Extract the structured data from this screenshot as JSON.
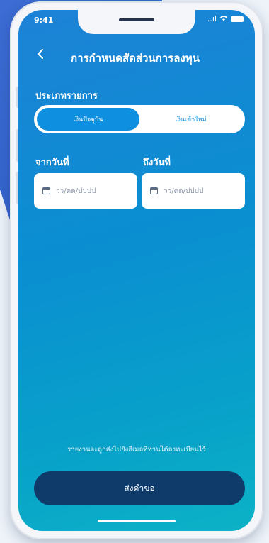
{
  "status": {
    "time": "9:41",
    "signal": "..ıl"
  },
  "header": {
    "back_icon": "chevron-left-icon",
    "title": "การกำหนดสัดส่วนการลงทุน"
  },
  "type_section": {
    "label": "ประเภทรายการ",
    "options": [
      {
        "label": "เงินปัจจุบัน",
        "selected": true
      },
      {
        "label": "เงินเข้าใหม่",
        "selected": false
      }
    ]
  },
  "date_range": {
    "from": {
      "label": "จากวันที่",
      "placeholder": "วว/ดด/ปปปป",
      "icon": "calendar-icon"
    },
    "to": {
      "label": "ถึงวันที่",
      "placeholder": "วว/ดด/ปปปป",
      "icon": "calendar-icon"
    }
  },
  "footer": {
    "note": "รายงานจะถูกส่งไปยังอีเมลที่ท่านได้ลงทะเบียนไว้",
    "submit_label": "ส่งคำขอ"
  },
  "colors": {
    "accent": "#0f8fe0",
    "button": "#0f3b6a",
    "gradient_top": "#1d82d6",
    "gradient_bottom": "#0cb2c6"
  }
}
